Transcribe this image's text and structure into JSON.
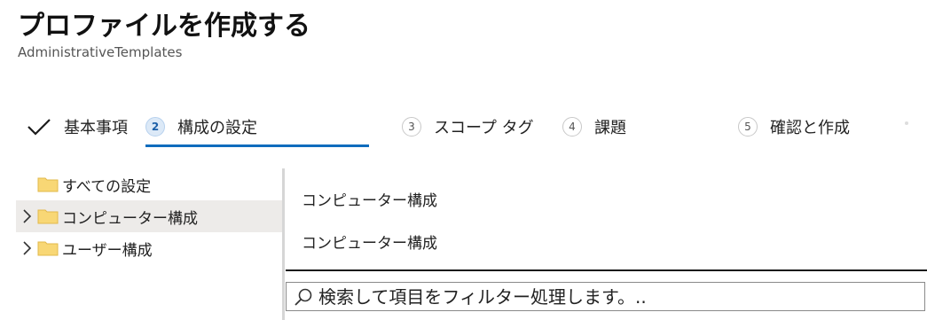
{
  "header": {
    "title": "プロファイルを作成する",
    "subtitle": "AdministrativeTemplates"
  },
  "steps": [
    {
      "number": "",
      "label": "基本事項",
      "state": "completed"
    },
    {
      "number": "2",
      "label": "構成の設定",
      "state": "active"
    },
    {
      "number": "3",
      "label": "スコープ タグ",
      "state": "pending"
    },
    {
      "number": "4",
      "label": "課題",
      "state": "pending"
    },
    {
      "number": "5",
      "label": "確認と作成",
      "state": "pending"
    }
  ],
  "tree": {
    "items": [
      {
        "label": "すべての設定",
        "expandable": false,
        "selected": false,
        "icon": "folder-icon"
      },
      {
        "label": "コンピューター構成",
        "expandable": true,
        "selected": true,
        "icon": "folder-icon"
      },
      {
        "label": "ユーザー構成",
        "expandable": true,
        "selected": false,
        "icon": "folder-icon"
      }
    ]
  },
  "details": {
    "breadcrumb": "コンピューター構成",
    "heading": "コンピューター構成"
  },
  "search": {
    "placeholder": "検索して項目をフィルター処理します。..",
    "value": ""
  },
  "colors": {
    "accent": "#0f6cbd",
    "selected_bg": "#edebe9",
    "folder": "#f8d775"
  }
}
